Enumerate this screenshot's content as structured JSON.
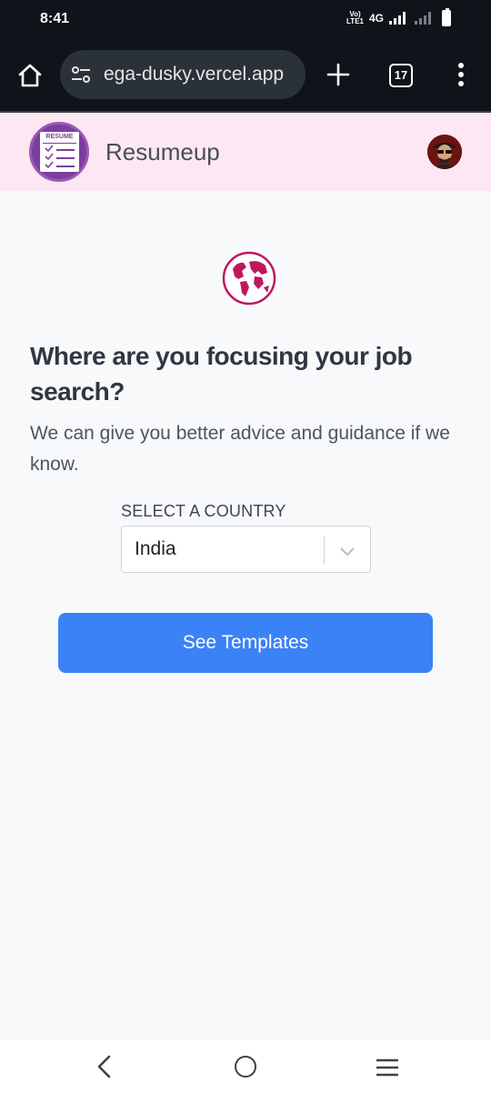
{
  "status_bar": {
    "time": "8:41",
    "volte_top": "Vo)",
    "volte_bottom": "LTE1",
    "network": "4G"
  },
  "browser": {
    "url": "ega-dusky.vercel.app",
    "tab_count": "17",
    "icons": [
      "home-icon",
      "site-settings-icon",
      "plus-icon",
      "tabs-icon",
      "more-vert-icon"
    ]
  },
  "app": {
    "title": "Resumeup",
    "logo_text": "RESUME",
    "brand_color": "#fce7f3"
  },
  "main": {
    "heading": "Where are you focusing your job search?",
    "subtext": "We can give you better advice and guidance if we know.",
    "select_label": "SELECT A COUNTRY",
    "selected_country": "India",
    "cta_label": "See Templates",
    "accent_color": "#3b82f6",
    "globe_color": "#be185d"
  },
  "nav": {
    "icons": [
      "back-icon",
      "home-circle-icon",
      "recents-icon"
    ]
  }
}
